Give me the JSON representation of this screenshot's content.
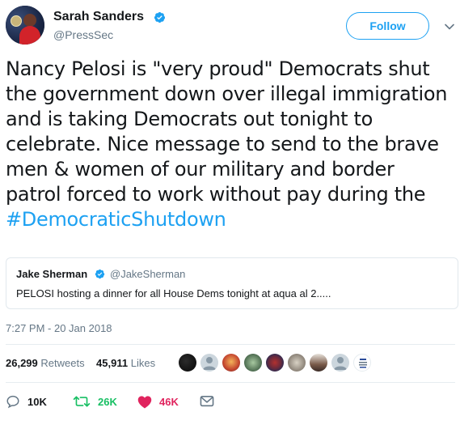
{
  "author": {
    "name": "Sarah Sanders",
    "handle": "@PressSec"
  },
  "follow_label": "Follow",
  "tweet": {
    "text": "Nancy Pelosi is \"very proud\" Democrats shut the government down over illegal immigration and is taking Democrats out tonight to celebrate. Nice message to send to the brave men & women of our military and border patrol forced to work without pay during the ",
    "hashtag": "#DemocraticShutdown"
  },
  "quote": {
    "name": "Jake Sherman",
    "handle": "@JakeSherman",
    "text": "PELOSI hosting a dinner for all House Dems tonight at aqua al 2....."
  },
  "timestamp": "7:27 PM - 20 Jan 2018",
  "stats": {
    "retweets_count": "26,299",
    "retweets_label": "Retweets",
    "likes_count": "45,911",
    "likes_label": "Likes"
  },
  "actions": {
    "replies": "10K",
    "retweets": "26K",
    "likes": "46K"
  },
  "colors": {
    "accent": "#1da1f2",
    "retweet_green": "#17bf63",
    "like_red": "#e0245e",
    "secondary_text": "#657786"
  },
  "icons": [
    "verified-badge-icon",
    "chevron-down-icon",
    "reply-icon",
    "retweet-icon",
    "heart-icon",
    "direct-message-icon"
  ]
}
